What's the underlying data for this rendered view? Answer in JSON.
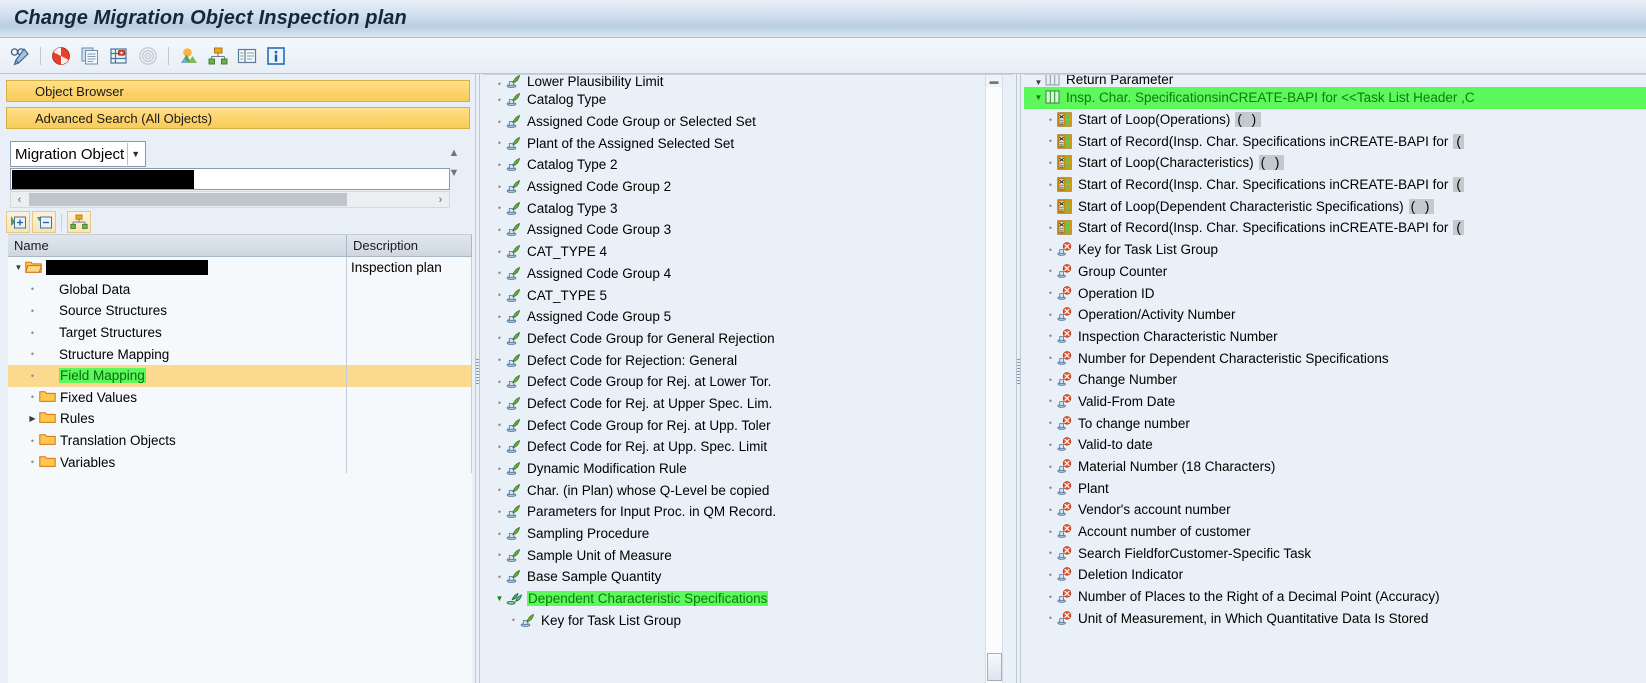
{
  "window": {
    "title": "Change Migration Object Inspection plan"
  },
  "toolbar": {
    "buttons": [
      {
        "name": "display-change-icon",
        "label": "Display/Change"
      },
      {
        "name": "stop-icon",
        "label": "Cancel"
      },
      {
        "name": "copy-icon",
        "label": "Copy"
      },
      {
        "name": "tasklist-icon",
        "label": "Task List"
      },
      {
        "name": "spiral-icon",
        "label": "Refresh"
      },
      {
        "name": "simulate-icon",
        "label": "Simulate"
      },
      {
        "name": "structure-icon",
        "label": "Structure"
      },
      {
        "name": "table-icon",
        "label": "Table View"
      },
      {
        "name": "info-icon",
        "label": "Information"
      }
    ]
  },
  "left_panel": {
    "accordion": [
      {
        "label": "Object Browser"
      },
      {
        "label": "Advanced Search (All Objects)"
      }
    ],
    "search": {
      "selected_type": "Migration Object",
      "options": [
        "Migration Object"
      ],
      "value": "",
      "placeholder": ""
    },
    "tree_toolbar": [
      {
        "name": "expand-all-icon",
        "label": "Expand All"
      },
      {
        "name": "collapse-all-icon",
        "label": "Collapse All"
      },
      {
        "name": "hierarchy-icon",
        "label": "Show Hierarchy"
      }
    ],
    "columns": [
      "Name",
      "Description"
    ],
    "rows": [
      {
        "label": "",
        "description": "Inspection plan",
        "level": 0,
        "icon": "folder-open-icon",
        "twisty": "down",
        "redacted": true,
        "selected": false
      },
      {
        "label": "Global Data",
        "description": "",
        "level": 1,
        "icon": "none",
        "twisty": "dot",
        "selected": false
      },
      {
        "label": "Source Structures",
        "description": "",
        "level": 1,
        "icon": "none",
        "twisty": "dot",
        "selected": false
      },
      {
        "label": "Target Structures",
        "description": "",
        "level": 1,
        "icon": "none",
        "twisty": "dot",
        "selected": false
      },
      {
        "label": "Structure Mapping",
        "description": "",
        "level": 1,
        "icon": "none",
        "twisty": "dot",
        "selected": false
      },
      {
        "label": "Field Mapping",
        "description": "",
        "level": 1,
        "icon": "none",
        "twisty": "dot",
        "selected": true,
        "highlight": "green"
      },
      {
        "label": "Fixed Values",
        "description": "",
        "level": 1,
        "icon": "folder-icon",
        "twisty": "dot",
        "selected": false
      },
      {
        "label": "Rules",
        "description": "",
        "level": 1,
        "icon": "folder-icon",
        "twisty": "right",
        "selected": false
      },
      {
        "label": "Translation Objects",
        "description": "",
        "level": 1,
        "icon": "folder-icon",
        "twisty": "dot",
        "selected": false
      },
      {
        "label": "Variables",
        "description": "",
        "level": 1,
        "icon": "folder-icon",
        "twisty": "dot",
        "selected": false
      }
    ]
  },
  "middle_panel": {
    "rows": [
      {
        "label": "Lower Plausibility Limit",
        "icon": "field-icon",
        "clipped": true
      },
      {
        "label": "Catalog Type",
        "icon": "field-icon"
      },
      {
        "label": "Assigned Code Group or Selected Set",
        "icon": "field-icon"
      },
      {
        "label": "Plant of the Assigned Selected Set",
        "icon": "field-icon"
      },
      {
        "label": "Catalog Type 2",
        "icon": "field-icon"
      },
      {
        "label": "Assigned Code Group 2",
        "icon": "field-icon"
      },
      {
        "label": "Catalog Type 3",
        "icon": "field-icon"
      },
      {
        "label": "Assigned Code Group 3",
        "icon": "field-icon"
      },
      {
        "label": "CAT_TYPE 4",
        "icon": "field-icon"
      },
      {
        "label": "Assigned Code Group 4",
        "icon": "field-icon"
      },
      {
        "label": "CAT_TYPE 5",
        "icon": "field-icon"
      },
      {
        "label": "Assigned Code Group 5",
        "icon": "field-icon"
      },
      {
        "label": "Defect Code Group for General Rejection",
        "icon": "field-icon"
      },
      {
        "label": "Defect Code for Rejection: General",
        "icon": "field-icon"
      },
      {
        "label": "Defect Code Group for Rej. at Lower Tor.",
        "icon": "field-icon"
      },
      {
        "label": "Defect Code for Rej. at Upper Spec. Lim.",
        "icon": "field-icon"
      },
      {
        "label": "Defect Code Group for Rej. at Upp. Toler",
        "icon": "field-icon"
      },
      {
        "label": "Defect Code for Rej. at Upp. Spec. Limit",
        "icon": "field-icon"
      },
      {
        "label": "Dynamic Modification Rule",
        "icon": "field-icon"
      },
      {
        "label": "Char. (in Plan) whose Q-Level be copied",
        "icon": "field-icon"
      },
      {
        "label": "Parameters for Input Proc. in QM Record.",
        "icon": "field-icon"
      },
      {
        "label": "Sampling Procedure",
        "icon": "field-icon"
      },
      {
        "label": "Sample Unit of Measure",
        "icon": "field-icon"
      },
      {
        "label": "Base Sample Quantity",
        "icon": "field-icon"
      },
      {
        "label": "Dependent Characteristic Specifications",
        "icon": "structure-node-icon",
        "twisty": "down",
        "highlight": "green",
        "level": 0
      },
      {
        "label": "Key for Task List Group",
        "icon": "field-icon",
        "level": 1
      }
    ]
  },
  "right_panel": {
    "rows": [
      {
        "label": "Return Parameter",
        "icon": "table-node-icon",
        "twisty": "down",
        "clipped": true,
        "level": 0
      },
      {
        "label": "Insp. Char. SpecificationsinCREATE-BAPI for <<Task List Header ,C",
        "icon": "table-node-icon",
        "twisty": "down",
        "highlight": "green",
        "level": 0
      },
      {
        "label": "Start of Loop(Operations)",
        "icon": "loop-icon",
        "level": 1,
        "paren": "(   )"
      },
      {
        "label": "Start of Record(Insp. Char. Specifications inCREATE-BAPI for",
        "icon": "loop-icon",
        "level": 1,
        "paren": "("
      },
      {
        "label": "Start of Loop(Characteristics)",
        "icon": "loop-icon",
        "level": 1,
        "paren": "(   )"
      },
      {
        "label": "Start of Record(Insp. Char. Specifications inCREATE-BAPI for",
        "icon": "loop-icon",
        "level": 1,
        "paren": "("
      },
      {
        "label": "Start of Loop(Dependent Characteristic Specifications)",
        "icon": "loop-icon",
        "level": 1,
        "paren": "(   )"
      },
      {
        "label": "Start of Record(Insp. Char. Specifications inCREATE-BAPI for",
        "icon": "loop-icon",
        "level": 1,
        "paren": "("
      },
      {
        "label": "Key for Task List Group",
        "icon": "target-field-icon",
        "level": 1
      },
      {
        "label": "Group Counter",
        "icon": "target-field-icon",
        "level": 1
      },
      {
        "label": "Operation ID",
        "icon": "target-field-icon",
        "level": 1
      },
      {
        "label": "Operation/Activity Number",
        "icon": "target-field-icon",
        "level": 1
      },
      {
        "label": "Inspection Characteristic Number",
        "icon": "target-field-icon",
        "level": 1
      },
      {
        "label": "Number for Dependent Characteristic Specifications",
        "icon": "target-field-icon",
        "level": 1
      },
      {
        "label": "Change Number",
        "icon": "target-field-icon",
        "level": 1
      },
      {
        "label": "Valid-From Date",
        "icon": "target-field-icon",
        "level": 1
      },
      {
        "label": "To change number",
        "icon": "target-field-icon",
        "level": 1
      },
      {
        "label": "Valid-to date",
        "icon": "target-field-icon",
        "level": 1
      },
      {
        "label": "Material Number (18 Characters)",
        "icon": "target-field-icon",
        "level": 1
      },
      {
        "label": "Plant",
        "icon": "target-field-icon",
        "level": 1
      },
      {
        "label": "Vendor's account number",
        "icon": "target-field-icon",
        "level": 1
      },
      {
        "label": "Account number of customer",
        "icon": "target-field-icon",
        "level": 1
      },
      {
        "label": "Search FieldforCustomer-Specific Task",
        "icon": "target-field-icon",
        "level": 1
      },
      {
        "label": "Deletion Indicator",
        "icon": "target-field-icon",
        "level": 1
      },
      {
        "label": "Number of Places to the Right of a Decimal Point (Accuracy)",
        "icon": "target-field-icon",
        "level": 1
      },
      {
        "label": "Unit of Measurement, in Which Quantitative Data Is Stored",
        "icon": "target-field-icon",
        "level": 1
      }
    ]
  },
  "colors": {
    "titlebar_text": "#14283c",
    "accordion_header": "#fcd36a",
    "selection_row": "#fbd98e",
    "highlight_green": "#5cf85c",
    "green_text": "#0f7a0f",
    "panel_bg": "#eaf0f7",
    "grid_bg": "#f6f9fc"
  }
}
